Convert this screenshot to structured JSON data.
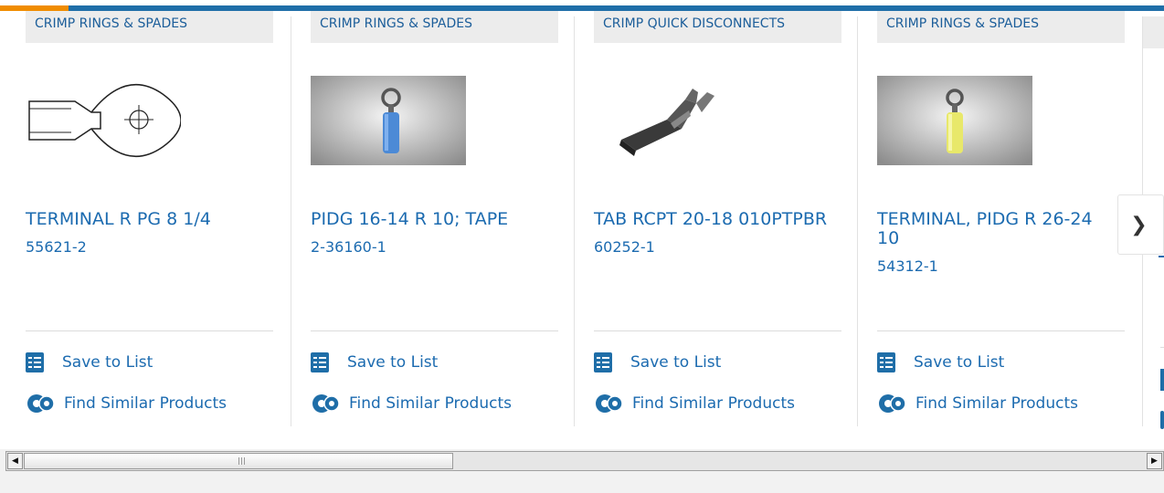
{
  "products": [
    {
      "category": "CRIMP RINGS & SPADES",
      "title": "TERMINAL R PG 8 1/4",
      "part_number": "55621-2",
      "image": "ring-terminal-drawing"
    },
    {
      "category": "CRIMP RINGS & SPADES",
      "title": "PIDG 16-14 R 10; TAPE",
      "part_number": "2-36160-1",
      "image": "blue-ring-terminal-photo"
    },
    {
      "category": "CRIMP QUICK DISCONNECTS",
      "title": "TAB RCPT 20-18 010PTPBR",
      "part_number": "60252-1",
      "image": "quick-disconnect-photo"
    },
    {
      "category": "CRIMP RINGS & SPADES",
      "title": "TERMINAL, PIDG R 26-24 10",
      "part_number": "54312-1",
      "image": "yellow-ring-terminal-photo"
    }
  ],
  "actions": {
    "save_label": "Save to List",
    "similar_label": "Find Similar Products"
  },
  "icons": {
    "save": "checklist-icon",
    "similar": "gears-icon",
    "next": "chevron-right-icon"
  },
  "colors": {
    "accent": "#f08c00",
    "brand": "#1f6ea8",
    "link": "#1c6bb0"
  },
  "scrollbar": {
    "left_arrow": "◀",
    "right_arrow": "▶"
  }
}
